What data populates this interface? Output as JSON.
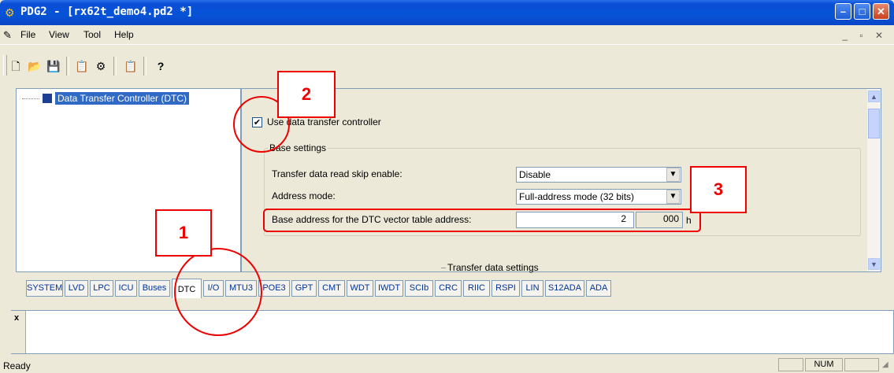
{
  "window": {
    "title": "PDG2 - [rx62t_demo4.pd2 *]",
    "app_icon": "gear-icon",
    "min": "–",
    "max": "□",
    "close": "✕"
  },
  "menu": {
    "items": [
      "File",
      "View",
      "Tool",
      "Help"
    ],
    "mdi_controls": "_ ▫ ✕"
  },
  "toolbar": {
    "buttons": [
      "new-icon",
      "open-icon",
      "save-icon",
      "report-icon",
      "generate-icon",
      "check-icon",
      "help-icon"
    ]
  },
  "tree": {
    "node_label": "Data Transfer Controller (DTC)"
  },
  "settings": {
    "use_dtc_label": "Use data transfer controller",
    "use_dtc_checked": true,
    "base_group_title": "Base settings",
    "read_skip_label": "Transfer data read skip enable:",
    "read_skip_value": "Disable",
    "address_mode_label": "Address mode:",
    "address_mode_value": "Full-address mode (32 bits)",
    "base_address_label": "Base address for the DTC vector table address:",
    "base_address_high": "2",
    "base_address_low": "000",
    "base_address_unit": "h",
    "transfer_group_title": "Transfer data settings"
  },
  "tabs": [
    "SYSTEM",
    "LVD",
    "LPC",
    "ICU",
    "Buses",
    "DTC",
    "I/O",
    "MTU3",
    "POE3",
    "GPT",
    "CMT",
    "WDT",
    "IWDT",
    "SCIb",
    "CRC",
    "RIIC",
    "RSPI",
    "LIN",
    "S12ADA",
    "ADA"
  ],
  "active_tab": "DTC",
  "output": {
    "close": "x",
    "text": ""
  },
  "status": {
    "text": "Ready",
    "num": "NUM"
  },
  "annotations": {
    "callout_1": "1",
    "callout_2": "2",
    "callout_3": "3",
    "color": "#e00000"
  }
}
